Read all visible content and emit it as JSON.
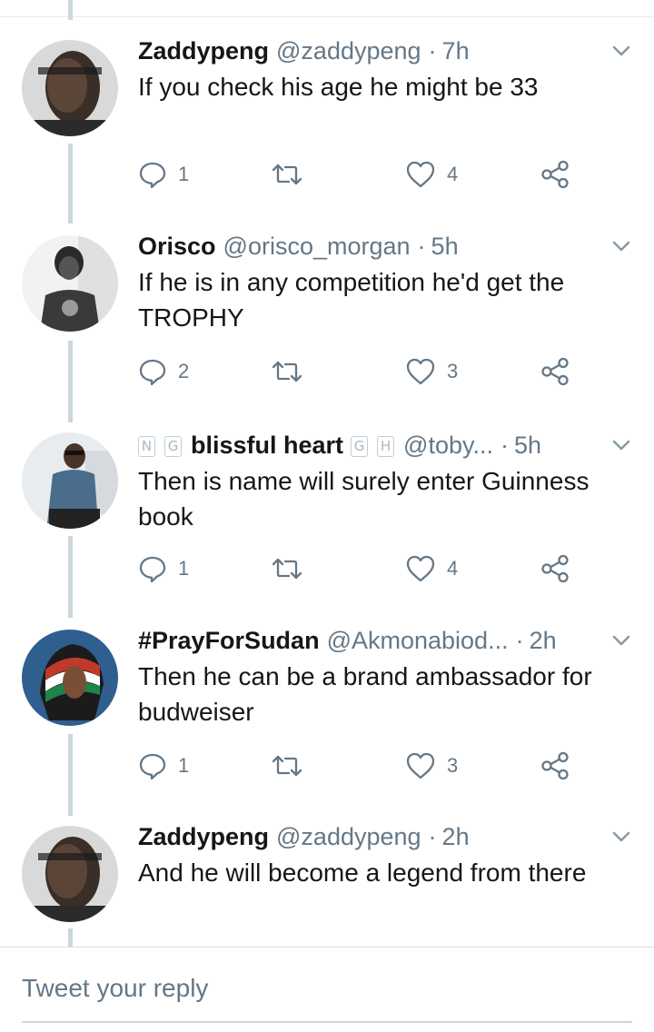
{
  "colors": {
    "secondary_text": "#657786",
    "primary_text": "#14171a",
    "thread_line": "#ccd6dd",
    "icon": "#657786"
  },
  "icons": {
    "reply": "speech-bubble-icon",
    "retweet": "retweet-arrows-icon",
    "like": "heart-icon",
    "share": "share-nodes-icon",
    "menu": "chevron-down-icon"
  },
  "tweets": [
    {
      "name": "Zaddypeng",
      "handle": "@zaddypeng",
      "separator": "·",
      "time": "7h",
      "text": "If you check his age he might be 33",
      "replies": "1",
      "retweets": "",
      "likes": "4"
    },
    {
      "name": "Orisco",
      "handle": "@orisco_morgan",
      "separator": "·",
      "time": "5h",
      "text": "If he is in any competition he'd get the TROPHY",
      "replies": "2",
      "retweets": "",
      "likes": "3"
    },
    {
      "name_prefix_badges": [
        "N",
        "G"
      ],
      "name": "blissful heart",
      "name_suffix_badges": [
        "G",
        "H"
      ],
      "handle": "@toby...",
      "separator": "·",
      "time": "5h",
      "text": "Then is name will surely enter Guinness book",
      "replies": "1",
      "retweets": "",
      "likes": "4"
    },
    {
      "name": "#PrayForSudan",
      "handle": "@Akmonabiod...",
      "separator": "·",
      "time": "2h",
      "text": "Then he can be a brand ambassador for budweiser",
      "replies": "1",
      "retweets": "",
      "likes": "3"
    },
    {
      "name": "Zaddypeng",
      "handle": "@zaddypeng",
      "separator": "·",
      "time": "2h",
      "text": "And he will become a legend from there"
    }
  ],
  "reply_box": {
    "placeholder": "Tweet your reply"
  }
}
